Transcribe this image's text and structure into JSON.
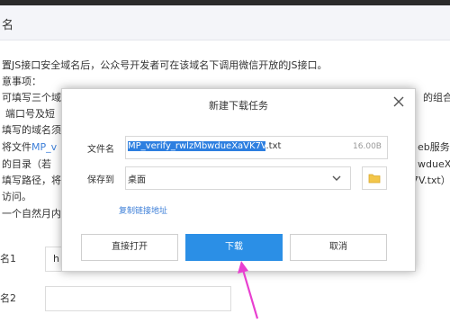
{
  "page": {
    "header_title": "名",
    "lines": [
      "置JS接口安全域名后，公众号开发者可在该域名下调用微信开放的JS接口。",
      "意事项：",
      "可填写三个域",
      "端口号及短",
      "填写的域名须",
      "将文件",
      "的目录（若",
      "填写路径，将",
      "访问。",
      "一个自然月内"
    ],
    "link_fragment": "MP_v",
    "right_lines": [
      "的组合，",
      "eb服务器",
      "wdueXa'",
      "7V.txt）"
    ],
    "field1_label": "名1",
    "field1_value": "h",
    "field2_label": "名2"
  },
  "dialog": {
    "title": "新建下载任务",
    "filename_label": "文件名",
    "filename_selected": "MP_verify_rwlzMbwdueXaVK7V",
    "filename_ext": ".txt",
    "filesize": "16.00B",
    "saveto_label": "保存到",
    "saveto_value": "桌面",
    "copy_link": "复制链接地址",
    "btn_open": "直接打开",
    "btn_download": "下载",
    "btn_cancel": "取消"
  },
  "colors": {
    "accent": "#2b8fe6",
    "link": "#3d7fd8",
    "selection": "#2d7fe0",
    "annotation_arrow": "#e83fd0"
  },
  "icons": [
    "close-icon",
    "chevron-down-icon",
    "folder-icon",
    "annotation-arrow"
  ]
}
